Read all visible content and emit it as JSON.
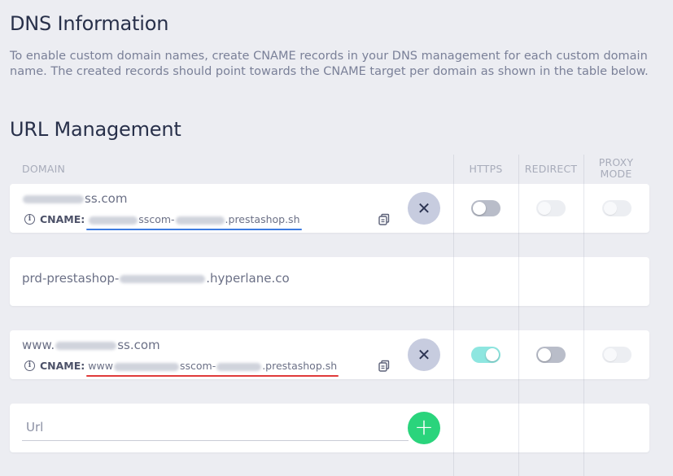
{
  "dns": {
    "title": "DNS Information",
    "description": "To enable custom domain names, create CNAME records in your DNS management for each custom domain name. The created records should point towards the CNAME target per domain as shown in the table below."
  },
  "url_management": {
    "title": "URL Management",
    "columns": {
      "domain": "DOMAIN",
      "https": "HTTPS",
      "redirect": "REDIRECT",
      "proxy_mode": "PROXY MODE"
    },
    "rows": [
      {
        "domain_suffix": "ss.com",
        "cname_label": "CNAME:",
        "cname_middle": "sscom-",
        "cname_suffix": ".prestashop.sh",
        "underline_color": "#3d7be0",
        "https": false,
        "redirect": false,
        "proxy_mode": false
      },
      {
        "domain_prefix": "prd-prestashop-",
        "domain_suffix": ".hyperlane.co"
      },
      {
        "domain_prefix": "www.",
        "domain_suffix": "ss.com",
        "cname_label": "CNAME:",
        "cname_prefix": "www",
        "cname_middle": "sscom-",
        "cname_suffix": ".prestashop.sh",
        "underline_color": "#e03a3a",
        "https": true,
        "redirect": false,
        "proxy_mode": false
      }
    ],
    "new_url": {
      "placeholder": "Url",
      "value": ""
    }
  },
  "icons": {
    "remove": "close-icon",
    "add": "plus-icon",
    "copy": "copy-icon",
    "info": "info-icon"
  },
  "colors": {
    "accent_add": "#2ad47c",
    "remove_button": "#c7ccdf",
    "toggle_on": "#8ee6e0"
  }
}
